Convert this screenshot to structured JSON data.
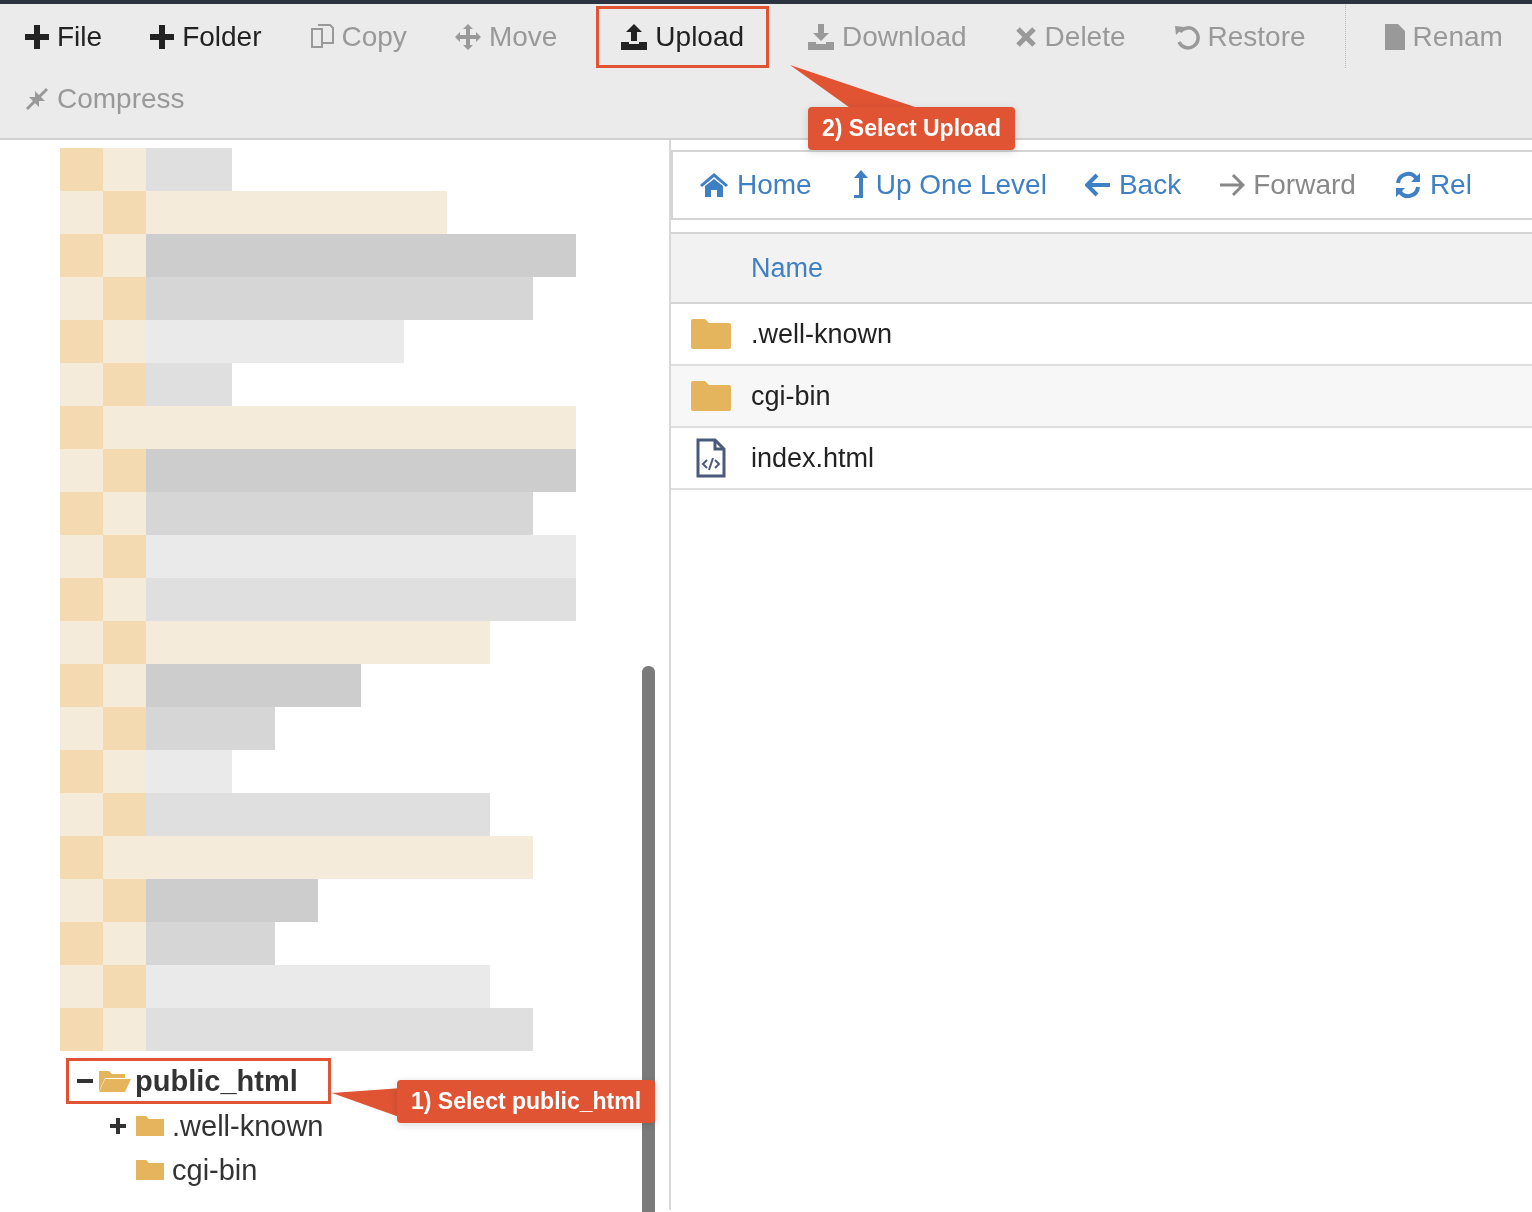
{
  "toolbar": [
    {
      "label": "File",
      "kind": "plus",
      "disabled": false,
      "highlighted": false
    },
    {
      "label": "Folder",
      "kind": "plus",
      "disabled": false,
      "highlighted": false
    },
    {
      "label": "Copy",
      "kind": "copy",
      "disabled": true,
      "highlighted": false
    },
    {
      "label": "Move",
      "kind": "move",
      "disabled": true,
      "highlighted": false
    },
    {
      "label": "Upload",
      "kind": "upload",
      "disabled": false,
      "highlighted": true
    },
    {
      "label": "Download",
      "kind": "download",
      "disabled": true,
      "highlighted": false
    },
    {
      "label": "Delete",
      "kind": "delete",
      "disabled": true,
      "highlighted": false
    },
    {
      "label": "Restore",
      "kind": "restore",
      "disabled": true,
      "highlighted": false
    },
    {
      "label": "Renam",
      "kind": "rename",
      "disabled": true,
      "highlighted": false
    },
    {
      "label": "Compress",
      "kind": "compress",
      "disabled": true,
      "highlighted": false
    }
  ],
  "callouts": [
    {
      "text": "2) Select Upload",
      "kind": "toolbar"
    },
    {
      "text": "1) Select public_html",
      "kind": "tree"
    }
  ],
  "tree": [
    {
      "label": "public_html",
      "expanded": true,
      "selected": true,
      "highlighted": true,
      "children": [
        {
          "label": ".well-known",
          "selected": false,
          "expandable": true
        },
        {
          "label": "cgi-bin",
          "selected": false,
          "expandable": false
        }
      ]
    }
  ],
  "nav": [
    {
      "label": "Home",
      "kind": "home",
      "disabled": false
    },
    {
      "label": "Up One Level",
      "kind": "up",
      "disabled": false
    },
    {
      "label": "Back",
      "kind": "back",
      "disabled": false
    },
    {
      "label": "Forward",
      "kind": "forward",
      "disabled": true
    },
    {
      "label": "Rel",
      "kind": "reload",
      "disabled": false
    }
  ],
  "table": {
    "columns": [
      "Name"
    ],
    "rows": [
      {
        "name": ".well-known",
        "kind": "folder"
      },
      {
        "name": "cgi-bin",
        "kind": "folder"
      },
      {
        "name": "index.html",
        "kind": "code-file"
      }
    ]
  }
}
